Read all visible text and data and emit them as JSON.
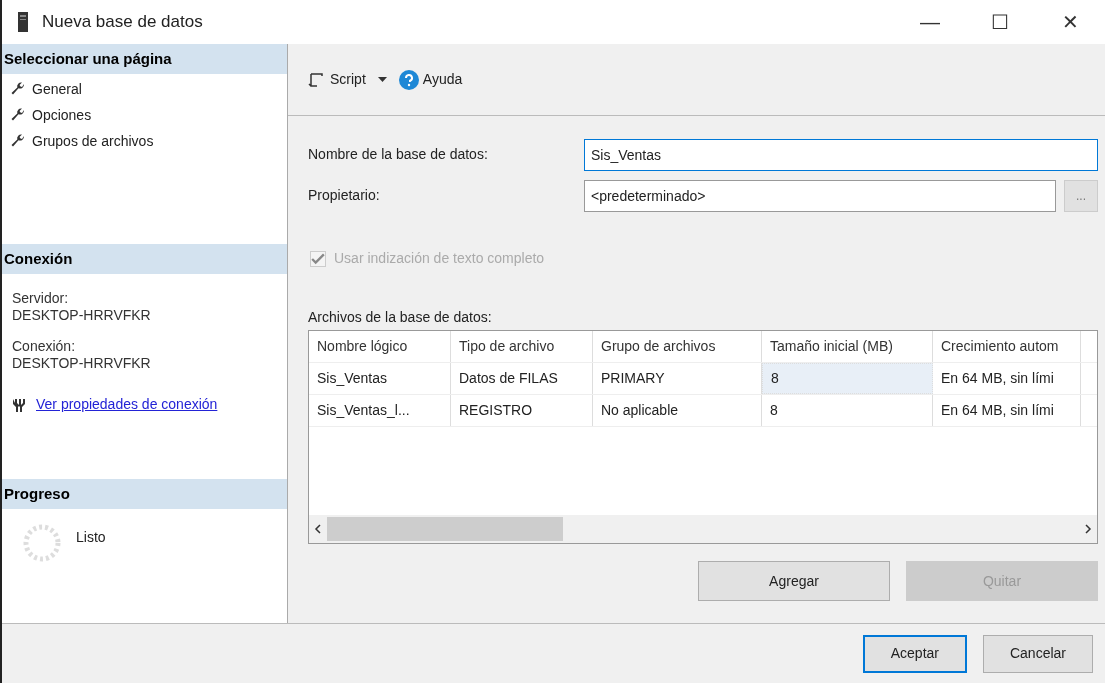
{
  "window": {
    "title": "Nueva base de datos",
    "controls": [
      "—",
      "☐",
      "✕"
    ]
  },
  "sidebar": {
    "sections": [
      {
        "kind": "pages",
        "title": "Seleccionar una página",
        "items": [
          "General",
          "Opciones",
          "Grupos de archivos"
        ]
      },
      {
        "kind": "connection",
        "title": "Conexión",
        "fields": [
          {
            "label": "Servidor:",
            "value": "DESKTOP-HRRVFKR"
          },
          {
            "label": "Conexión:",
            "value": "DESKTOP-HRRVFKR"
          }
        ],
        "link": "Ver propiedades de conexión"
      },
      {
        "kind": "progress",
        "title": "Progreso",
        "status": "Listo"
      }
    ]
  },
  "toolbar": {
    "script": "Script",
    "help": "Ayuda"
  },
  "form": {
    "fields": [
      {
        "label": "Nombre de la base de datos:",
        "value": "Sis_Ventas",
        "focused": true
      },
      {
        "label": "Propietario:",
        "value": "<predeterminado>",
        "focused": false,
        "browse_label": "..."
      }
    ],
    "fulltext": {
      "label": "Usar indización de texto completo",
      "checked": true,
      "disabled": true
    }
  },
  "files": {
    "label": "Archivos de la base de datos:",
    "columns": [
      "Nombre lógico",
      "Tipo de archivo",
      "Grupo de archivos",
      "Tamaño inicial (MB)",
      "Crecimiento autom"
    ],
    "rows": [
      {
        "cells": [
          {
            "text": "Sis_Ventas",
            "focused": false
          },
          {
            "text": "Datos de FILAS",
            "focused": false
          },
          {
            "text": "PRIMARY",
            "focused": false
          },
          {
            "text": "8",
            "focused": true
          },
          {
            "text": "En 64 MB, sin lími",
            "focused": false
          }
        ]
      },
      {
        "cells": [
          {
            "text": "Sis_Ventas_l...",
            "focused": false
          },
          {
            "text": "REGISTRO",
            "focused": false
          },
          {
            "text": "No aplicable",
            "focused": false
          },
          {
            "text": "8",
            "focused": false
          },
          {
            "text": "En 64 MB, sin lími",
            "focused": false
          }
        ]
      }
    ],
    "buttons": [
      {
        "label": "Agregar",
        "disabled": false
      },
      {
        "label": "Quitar",
        "disabled": true
      }
    ]
  },
  "footer": {
    "buttons": [
      {
        "label": "Aceptar",
        "default": true
      },
      {
        "label": "Cancelar",
        "default": false
      }
    ]
  }
}
